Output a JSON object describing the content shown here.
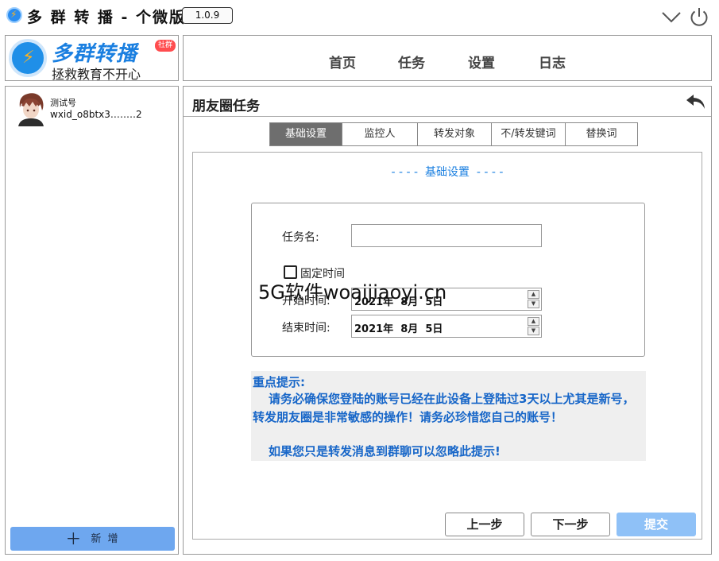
{
  "app": {
    "title": "多 群 转 播 - 个微版",
    "version": "1.0.9"
  },
  "logo": {
    "brand": "多群转播",
    "badge": "社群",
    "slogan": "拯救教育不开心"
  },
  "nav": {
    "items": [
      "首页",
      "任务",
      "设置",
      "日志"
    ]
  },
  "account": {
    "name": "测试号",
    "wxid": "wxid_o8btx3․․․․․․․․2"
  },
  "sidebar": {
    "add_label": "新 增"
  },
  "page": {
    "title": "朋友圈任务"
  },
  "tabs": [
    "基础设置",
    "监控人",
    "转发对象",
    "不/转发键词",
    "替换词"
  ],
  "form": {
    "section_title": "- - - -  基础设置  - - - -",
    "task_name_label": "任务名:",
    "task_name_value": "",
    "fixed_time_label": "固定时间",
    "start_time_label": "开始时间:",
    "start_time_value": "2021年  8月  5日",
    "end_time_label": "结束时间:",
    "end_time_value": "2021年  8月  5日"
  },
  "watermark": "5G软件woaijiaoyi.cn",
  "notice": {
    "heading": "重点提示:",
    "body": "请务必确保您登陆的账号已经在此设备上登陆过3天以上尤其是新号，转发朋友圈是非常敏感的操作！请务必珍惜您自己的账号！",
    "tip": "如果您只是转发消息到群聊可以忽略此提示!"
  },
  "buttons": {
    "prev": "上一步",
    "next": "下一步",
    "submit": "提交"
  },
  "colors": {
    "accent": "#1a7fe0",
    "tab_active": "#6e6e6e",
    "submit": "#8fc1f7",
    "add": "#6ea7ef"
  }
}
